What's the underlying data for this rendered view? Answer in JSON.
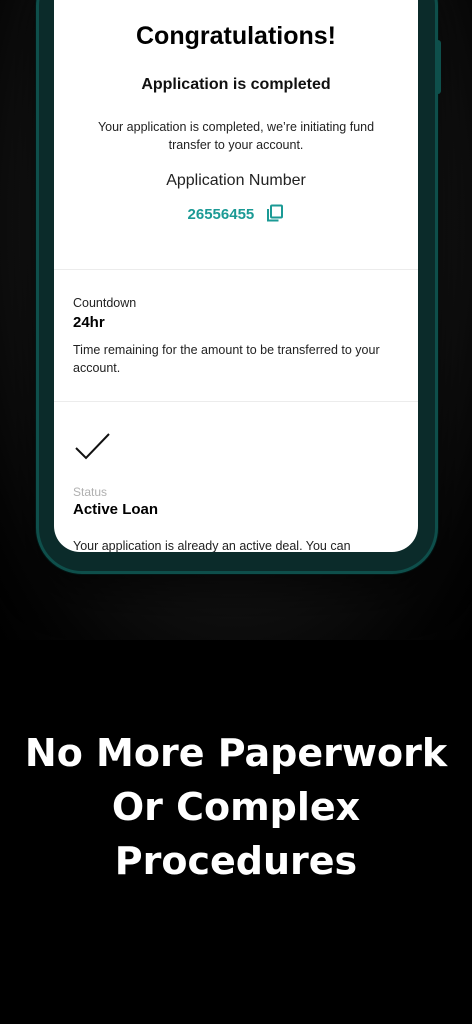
{
  "card": {
    "title": "Congratulations!",
    "subtitle": "Application is completed",
    "description": "Your application is completed, we’re initiating fund transfer to your account.",
    "application_number_label": "Application Number",
    "application_number": "26556455",
    "copy_icon": "copy-icon"
  },
  "countdown": {
    "label": "Countdown",
    "value": "24hr",
    "description": "Time remaining for the amount to be transferred to your account."
  },
  "status": {
    "icon": "check-icon",
    "label": "Status",
    "value": "Active Loan",
    "description": "Your application is already an active deal. You can"
  },
  "promo": {
    "line1": "No More Paperwork",
    "line2": "Or Complex",
    "line3": "Procedures"
  },
  "colors": {
    "accent": "#1b9a95",
    "phone_frame": "#0e4f4b",
    "background": "#000000"
  }
}
